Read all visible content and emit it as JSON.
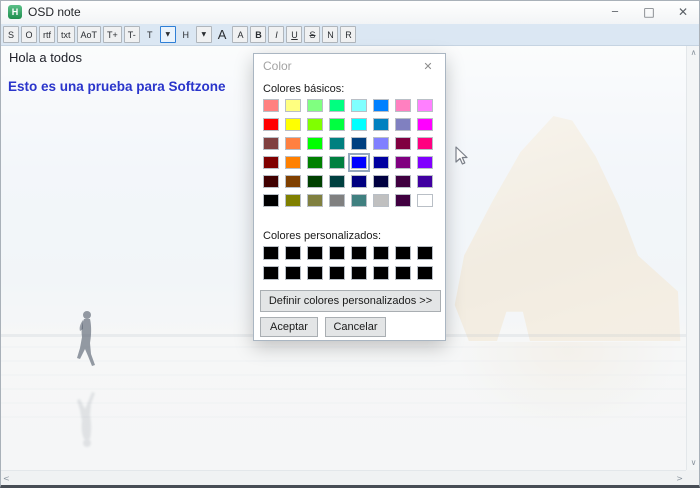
{
  "window": {
    "title": "OSD note",
    "app_icon_letter": "H",
    "app_icon_color": "#2fa05a",
    "controls": {
      "minimize": "─",
      "maximize": "□",
      "close": "✕"
    }
  },
  "toolbar": {
    "buttons": [
      {
        "name": "save-button",
        "label": "S"
      },
      {
        "name": "open-button",
        "label": "O"
      },
      {
        "name": "rtf-button",
        "label": "rtf"
      },
      {
        "name": "txt-button",
        "label": "txt"
      },
      {
        "name": "always-on-top-button",
        "label": "AoT"
      },
      {
        "name": "text-larger-button",
        "label": "T+"
      },
      {
        "name": "text-smaller-button",
        "label": "T-"
      },
      {
        "name": "text-color-button",
        "label": "T",
        "flat": true
      },
      {
        "name": "text-color-dropdown",
        "label": "▼",
        "small": true,
        "focused": true
      },
      {
        "name": "highlight-button",
        "label": "H",
        "flat": true
      },
      {
        "name": "highlight-dropdown",
        "label": "▼",
        "small": true
      },
      {
        "name": "font-large-button",
        "label": "A",
        "flat": true,
        "large": true
      },
      {
        "name": "font-button",
        "label": "A"
      },
      {
        "name": "bold-button",
        "label": "B",
        "bold": true
      },
      {
        "name": "italic-button",
        "label": "I",
        "italic": true
      },
      {
        "name": "underline-button",
        "label": "U",
        "underline": true
      },
      {
        "name": "strikethrough-button",
        "label": "S",
        "strike": true
      },
      {
        "name": "normal-button",
        "label": "N"
      },
      {
        "name": "reset-button",
        "label": "R"
      }
    ]
  },
  "editor": {
    "line1": "Hola a todos",
    "line2": "Esto es una prueba para Softzone",
    "line2_color": "#2a35cb"
  },
  "dialog": {
    "title": "Color",
    "close": "✕",
    "basic_label": "Colores básicos:",
    "custom_label": "Colores personalizados:",
    "define_button": "Definir colores personalizados >>",
    "ok_button": "Aceptar",
    "cancel_button": "Cancelar",
    "selected_index": 28,
    "selected_color": "#0000FF",
    "basic_colors": [
      "#FF8080",
      "#FFFF80",
      "#80FF80",
      "#00FF80",
      "#80FFFF",
      "#0080FF",
      "#FF80C0",
      "#FF80FF",
      "#FF0000",
      "#FFFF00",
      "#80FF00",
      "#00FF40",
      "#00FFFF",
      "#0080C0",
      "#8080C0",
      "#FF00FF",
      "#804040",
      "#FF8040",
      "#00FF00",
      "#008080",
      "#004080",
      "#8080FF",
      "#800040",
      "#FF0080",
      "#800000",
      "#FF8000",
      "#008000",
      "#008040",
      "#0000FF",
      "#0000A0",
      "#800080",
      "#8000FF",
      "#400000",
      "#804000",
      "#004000",
      "#004040",
      "#000080",
      "#000040",
      "#400040",
      "#4000A0",
      "#000000",
      "#808000",
      "#808040",
      "#808080",
      "#408080",
      "#C0C0C0",
      "#400040",
      "#FFFFFF"
    ],
    "custom_colors": [
      "#000000",
      "#000000",
      "#000000",
      "#000000",
      "#000000",
      "#000000",
      "#000000",
      "#000000",
      "#000000",
      "#000000",
      "#000000",
      "#000000",
      "#000000",
      "#000000",
      "#000000",
      "#000000"
    ]
  },
  "scrollbars": {
    "up": "∧",
    "down": "∨",
    "left": "<",
    "right": ">"
  }
}
